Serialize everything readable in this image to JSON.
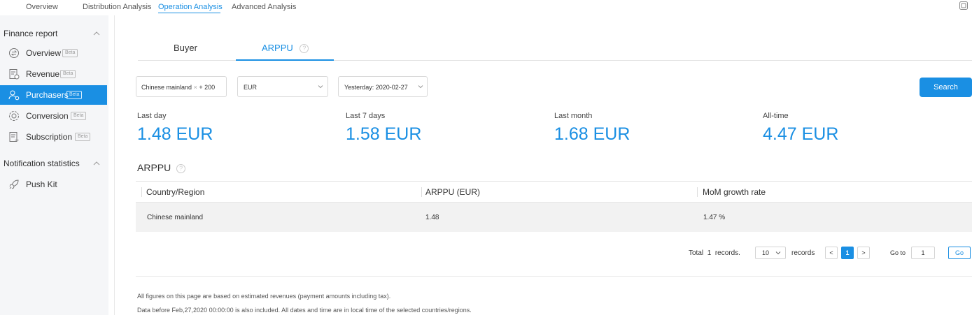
{
  "topnav": {
    "tabs": [
      {
        "label": "Overview"
      },
      {
        "label": "Distribution Analysis"
      },
      {
        "label": "Operation Analysis"
      },
      {
        "label": "Advanced Analysis"
      }
    ],
    "active_tab": "Operation Analysis"
  },
  "sidebar": {
    "groups": [
      {
        "title": "Finance report",
        "items": [
          {
            "label": "Overview",
            "badge": "Beta",
            "icon": "exchange-icon"
          },
          {
            "label": "Revenue",
            "badge": "Beta",
            "icon": "revenue-doc-icon"
          },
          {
            "label": "Purchasers",
            "badge": "Beta",
            "icon": "purchasers-icon",
            "active": true
          },
          {
            "label": "Conversion",
            "badge": "Beta",
            "icon": "conversion-icon"
          },
          {
            "label": "Subscription",
            "badge": "Beta",
            "icon": "subscription-icon"
          }
        ]
      },
      {
        "title": "Notification statistics",
        "items": [
          {
            "label": "Push Kit",
            "icon": "rocket-icon"
          }
        ]
      }
    ]
  },
  "content_tabs": [
    {
      "label": "Buyer"
    },
    {
      "label": "ARPPU",
      "help": "?"
    }
  ],
  "filters": {
    "region": {
      "value": "Chinese mainland",
      "clear": "×",
      "more": "+ 200"
    },
    "currency": {
      "value": "EUR"
    },
    "date": {
      "value": "Yesterday: 2020-02-27"
    },
    "search_label": "Search"
  },
  "metrics": [
    {
      "label": "Last day",
      "value": "1.48 EUR"
    },
    {
      "label": "Last 7 days",
      "value": "1.58 EUR"
    },
    {
      "label": "Last month",
      "value": "1.68 EUR"
    },
    {
      "label": "All-time",
      "value": "4.47 EUR"
    }
  ],
  "section": {
    "title": "ARPPU",
    "help": "?"
  },
  "table": {
    "columns": [
      "Country/Region",
      "ARPPU (EUR)",
      "MoM growth rate"
    ],
    "rows": [
      [
        "Chinese mainland",
        "1.48",
        "1.47 %"
      ]
    ]
  },
  "pagination": {
    "total_prefix": "Total",
    "total_count": "1",
    "total_suffix": "records.",
    "page_size": "10",
    "page_size_suffix": "records",
    "prev": "<",
    "current_page": "1",
    "next": ">",
    "goto_label": "Go to",
    "goto_value": "1",
    "go_label": "Go"
  },
  "notes": [
    "All figures on this page are based on estimated revenues (payment amounts including tax).",
    "Data before Feb,27,2020 00:00:00 is also included. All dates and time are in local time of the selected countries/regions."
  ],
  "colors": {
    "accent": "#1a8fe3",
    "sidebar_bg": "#f5f6f8",
    "row_bg": "#f2f2f2"
  }
}
